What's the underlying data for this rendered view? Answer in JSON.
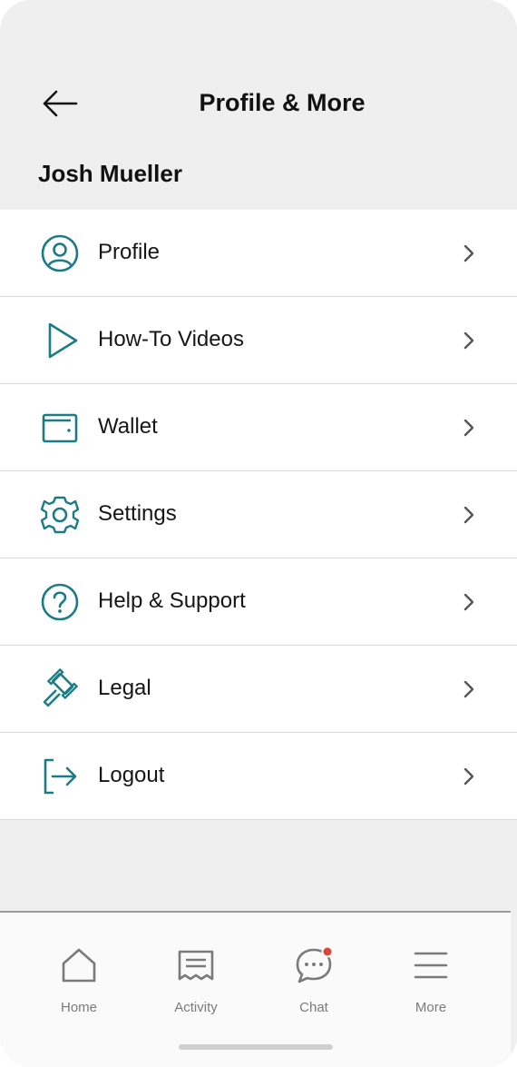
{
  "header": {
    "title": "Profile & More",
    "user_name": "Josh Mueller",
    "back_icon": "arrow-left-icon"
  },
  "menu": {
    "items": [
      {
        "label": "Profile",
        "icon": "user-circle-icon"
      },
      {
        "label": "How-To Videos",
        "icon": "play-icon"
      },
      {
        "label": "Wallet",
        "icon": "wallet-icon"
      },
      {
        "label": "Settings",
        "icon": "gear-icon"
      },
      {
        "label": "Help & Support",
        "icon": "help-circle-icon"
      },
      {
        "label": "Legal",
        "icon": "gavel-icon"
      },
      {
        "label": "Logout",
        "icon": "logout-icon"
      }
    ]
  },
  "tabbar": {
    "tabs": [
      {
        "label": "Home",
        "icon": "home-icon"
      },
      {
        "label": "Activity",
        "icon": "receipt-icon"
      },
      {
        "label": "Chat",
        "icon": "chat-icon"
      },
      {
        "label": "More",
        "icon": "menu-icon"
      }
    ]
  },
  "colors": {
    "accent": "#1b7c86",
    "background": "#efefef",
    "notification": "#d9453b",
    "tab_icon": "#7a7a7a"
  }
}
